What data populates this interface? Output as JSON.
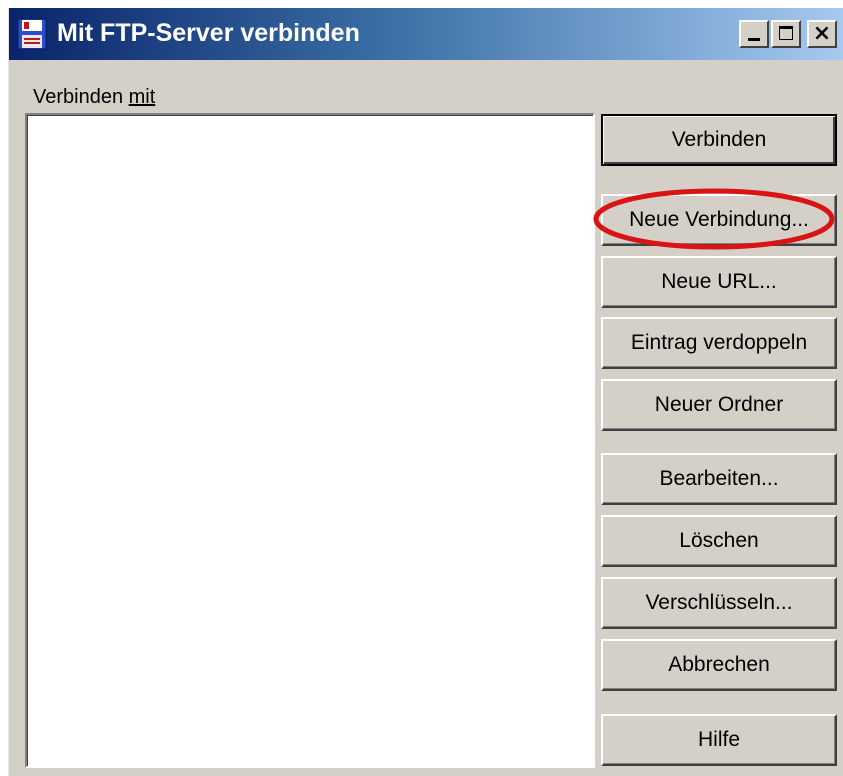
{
  "window": {
    "title": "Mit FTP-Server verbinden",
    "icon": "floppy-disk-icon",
    "controls": {
      "minimize": "minimize-icon",
      "maximize": "maximize-icon",
      "close": "×"
    }
  },
  "list_label": {
    "prefix": "Verbinden ",
    "accel": "mit"
  },
  "buttons": {
    "connect": "Verbinden",
    "new_connection": "Neue Verbindung...",
    "new_url": "Neue URL...",
    "duplicate": "Eintrag verdoppeln",
    "new_folder": "Neuer Ordner",
    "edit": "Bearbeiten...",
    "delete": "Löschen",
    "encrypt": "Verschlüsseln...",
    "cancel": "Abbrechen",
    "help": "Hilfe"
  },
  "colors": {
    "titlebar_start": "#0a246a",
    "titlebar_end": "#a6caf0",
    "annotation_ring": "#d81414"
  }
}
